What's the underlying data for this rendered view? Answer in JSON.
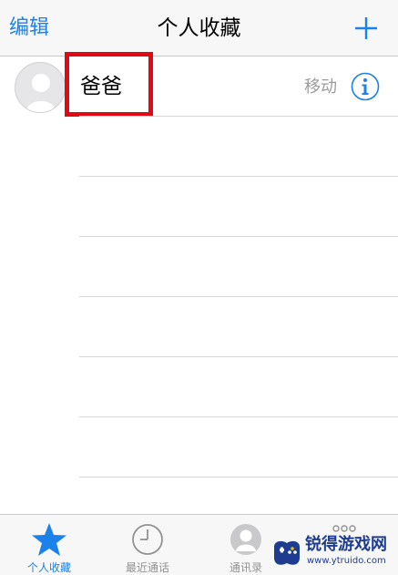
{
  "navbar": {
    "edit_label": "编辑",
    "title": "个人收藏",
    "add_icon": "plus-icon"
  },
  "favorites": [
    {
      "name": "爸爸",
      "phone_type": "移动",
      "avatar_icon": "default-avatar-icon",
      "info_icon": "info-icon"
    }
  ],
  "tabbar": {
    "tabs": [
      {
        "label": "个人收藏",
        "icon": "star-icon",
        "active": true
      },
      {
        "label": "最近通话",
        "icon": "clock-icon",
        "active": false
      },
      {
        "label": "通讯录",
        "icon": "contact-icon",
        "active": false
      },
      {
        "label": "",
        "icon": "keypad-icon",
        "active": false
      }
    ]
  },
  "watermark": {
    "title": "锐得游戏网",
    "url": "www.ytruido.com"
  },
  "colors": {
    "accent": "#1a82e8",
    "highlight": "#e10a14",
    "secondary_text": "#9c9c9c"
  }
}
